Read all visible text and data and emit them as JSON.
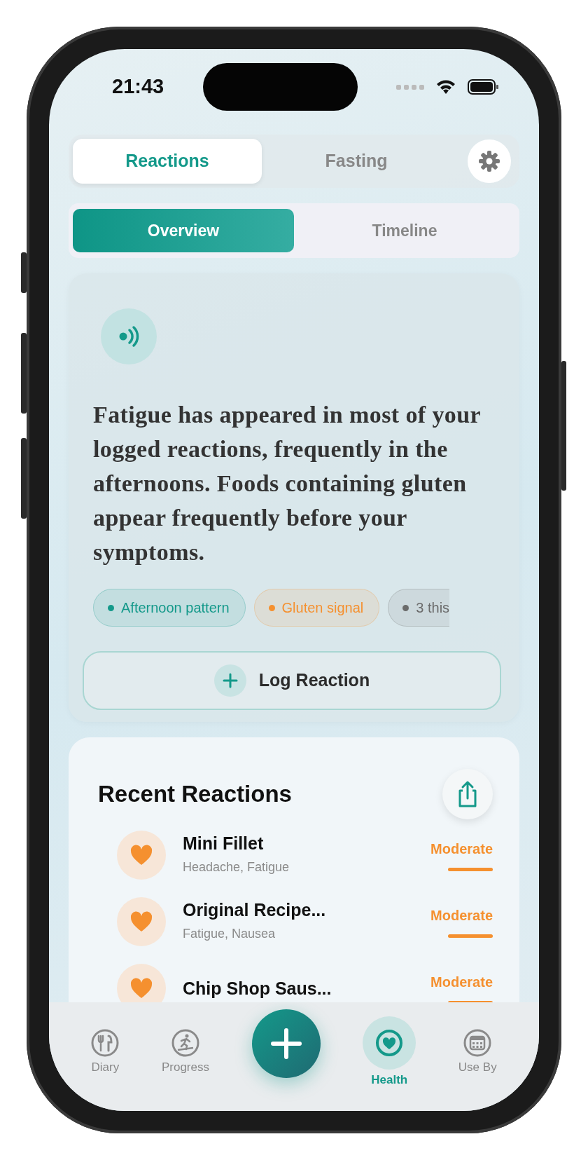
{
  "status_bar": {
    "time": "21:43"
  },
  "top_tabs": [
    {
      "label": "Reactions",
      "selected": true
    },
    {
      "label": "Fasting",
      "selected": false
    }
  ],
  "view_tabs": [
    {
      "label": "Overview",
      "selected": true
    },
    {
      "label": "Timeline",
      "selected": false
    }
  ],
  "insight": {
    "text": "Fatigue has appeared in most of your logged reactions, frequently in the afternoons. Foods containing gluten appear frequently before your symptoms.",
    "chips": [
      {
        "label": "Afternoon pattern",
        "color": "#14998a"
      },
      {
        "label": "Gluten signal",
        "color": "#f5902f"
      },
      {
        "label": "3 this",
        "color": "#6b6b6b"
      }
    ],
    "button": "Log Reaction"
  },
  "recent": {
    "title": "Recent Reactions",
    "items": [
      {
        "name": "Mini Fillet",
        "symptoms": "Headache, Fatigue",
        "severity": "Moderate"
      },
      {
        "name": "Original Recipe...",
        "symptoms": "Fatigue, Nausea",
        "severity": "Moderate"
      },
      {
        "name": "Chip Shop Saus...",
        "severity": "Moderate"
      }
    ]
  },
  "tab_bar": [
    {
      "kind": "diary",
      "label": "Diary",
      "selected": false
    },
    {
      "kind": "progress",
      "label": "Progress",
      "selected": false
    },
    {
      "kind": "add",
      "selected": false
    },
    {
      "kind": "health",
      "label": "Health",
      "selected": true
    },
    {
      "kind": "useby",
      "label": "Use By",
      "selected": false
    }
  ]
}
